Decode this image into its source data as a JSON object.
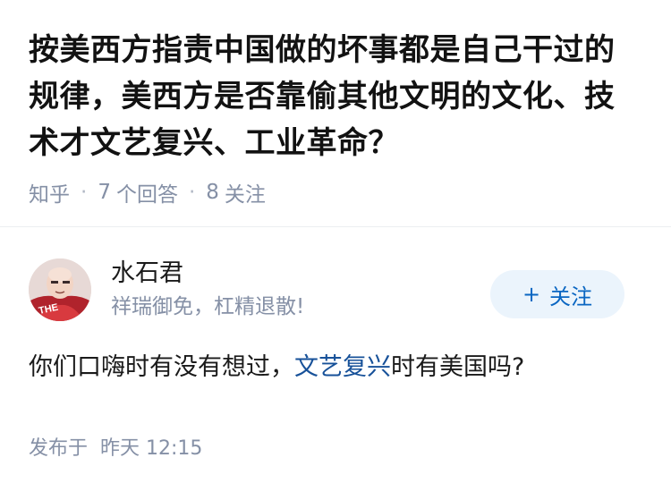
{
  "question": {
    "title": "按美西方指责中国做的坏事都是自己干过的规律，美西方是否靠偷其他文明的文化、技术才文艺复兴、工业革命？",
    "source": "知乎",
    "answer_count": "7",
    "answer_label": "个回答",
    "follower_count": "8",
    "follower_label": "关注"
  },
  "answer": {
    "author_name": "水石君",
    "author_bio": "祥瑞御免，杠精退散!",
    "follow_plus": "+",
    "follow_label": "关注",
    "content_before": "你们口嗨时有没有想过，",
    "content_link": "文艺复兴",
    "content_after": "时有美国吗?",
    "published_label": "发布于",
    "published_time": "昨天 12:15"
  },
  "avatar_text": "THE",
  "colors": {
    "link": "#175199",
    "follow_bg": "#ebf4fc",
    "follow_text": "#0a66c2",
    "muted": "#8590a6"
  }
}
